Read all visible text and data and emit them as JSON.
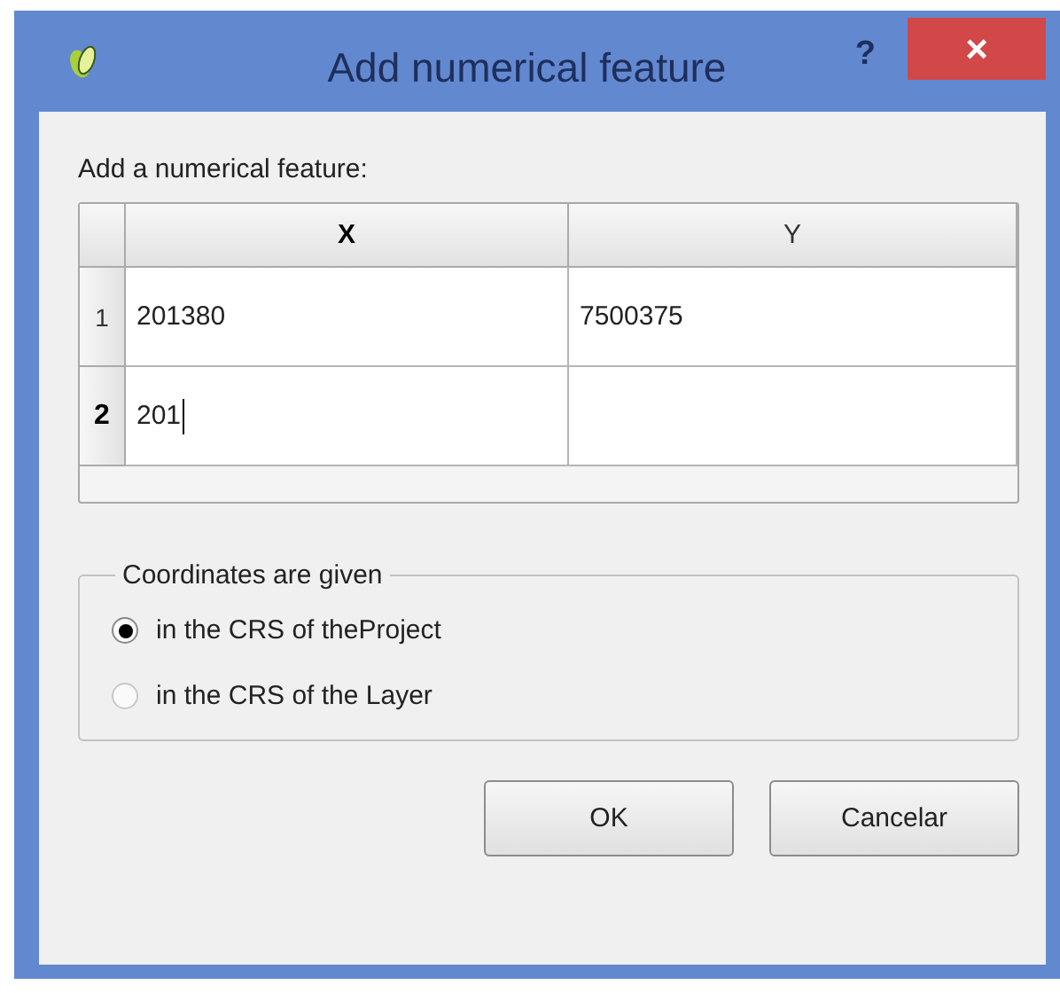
{
  "window": {
    "title": "Add numerical feature",
    "help": "?",
    "close": "×"
  },
  "prompt": "Add a numerical feature:",
  "table": {
    "columns": [
      {
        "label": "X",
        "current": true
      },
      {
        "label": "Y",
        "current": false
      }
    ],
    "rows": [
      {
        "number": "1",
        "current": false,
        "cells": [
          {
            "text": "201380",
            "editing": false
          },
          {
            "text": "7500375",
            "editing": false
          }
        ]
      },
      {
        "number": "2",
        "current": true,
        "cells": [
          {
            "text": "201",
            "editing": true
          }
        ]
      }
    ]
  },
  "group": {
    "title": "Coordinates are given",
    "options": [
      {
        "label": "in the CRS of theProject",
        "selected": true
      },
      {
        "label": "in the CRS of the Layer",
        "selected": false
      }
    ]
  },
  "buttons": [
    "OK",
    "Cancelar"
  ]
}
